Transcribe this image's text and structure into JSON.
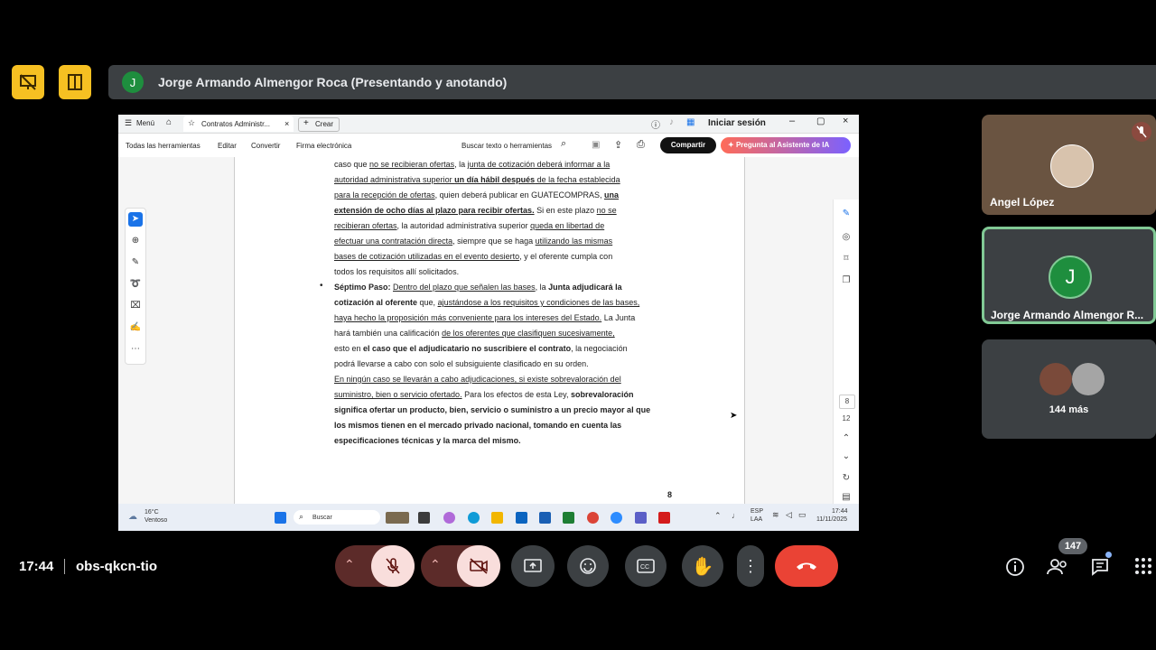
{
  "meeting": {
    "presenter_initial": "J",
    "presenter_title": "Jorge Armando Almengor Roca (Presentando y anotando)",
    "time": "17:44",
    "code": "obs-qkcn-tio",
    "participants_count": "147"
  },
  "window": {
    "menu_label": "Menú",
    "tab_title": "Contratos Administr...",
    "new_tab_label": "Crear",
    "signin_label": "Iniciar sesión",
    "toolbar_items": [
      "Todas las herramientas",
      "Editar",
      "Convertir",
      "Firma electrónica"
    ],
    "search_label": "Buscar texto o herramientas",
    "share_label": "Compartir",
    "ai_label": "Pregunta al Asistente de IA",
    "page_current": "8",
    "page_total": "12",
    "page_number": "8"
  },
  "doc_lines": [
    [
      {
        "t": "caso que "
      },
      {
        "t": "no se recibieran ofertas",
        "u": 1
      },
      {
        "t": ", la "
      },
      {
        "t": "junta de cotización deberá informar a la",
        "u": 1
      }
    ],
    [
      {
        "t": "autoridad administrativa superior ",
        "u": 1
      },
      {
        "t": "un día hábil después",
        "b": 1,
        "u": 1
      },
      {
        "t": " de la fecha establecida",
        "u": 1
      }
    ],
    [
      {
        "t": "para la recepción de ofertas",
        "u": 1
      },
      {
        "t": ", quien deberá publicar en GUATECOMPRAS, "
      },
      {
        "t": "una",
        "b": 1,
        "u": 1
      }
    ],
    [
      {
        "t": "extensión de ocho días al plazo para recibir ofertas.",
        "b": 1,
        "u": 1
      },
      {
        "t": " Si en este plazo "
      },
      {
        "t": "no se",
        "u": 1
      }
    ],
    [
      {
        "t": "recibieran ofertas",
        "u": 1
      },
      {
        "t": ", la autoridad administrativa superior "
      },
      {
        "t": "queda en libertad de",
        "u": 1
      }
    ],
    [
      {
        "t": "efectuar una contratación directa",
        "u": 1
      },
      {
        "t": ", siempre que se haga "
      },
      {
        "t": "utilizando las mismas",
        "u": 1
      }
    ],
    [
      {
        "t": "bases de cotización utilizadas en el evento desierto",
        "u": 1
      },
      {
        "t": ", y el oferente cumpla con"
      }
    ],
    [
      {
        "t": "todos los requisitos allí solicitados."
      }
    ],
    [
      {
        "t": "Séptimo Paso: ",
        "b": 1
      },
      {
        "t": "Dentro del plazo que señalen las bases",
        "u": 1
      },
      {
        "t": ", la "
      },
      {
        "t": "Junta adjudicará la",
        "b": 1
      }
    ],
    [
      {
        "t": "cotización al oferente",
        "b": 1
      },
      {
        "t": " que, "
      },
      {
        "t": "ajustándose a los requisitos y condiciones de las bases,",
        "u": 1
      }
    ],
    [
      {
        "t": "haya hecho la proposición más conveniente para los intereses del Estado.",
        "u": 1
      },
      {
        "t": " La Junta"
      }
    ],
    [
      {
        "t": "hará también una calificación "
      },
      {
        "t": "de los oferentes que clasifiquen sucesivamente,",
        "u": 1
      }
    ],
    [
      {
        "t": "esto en "
      },
      {
        "t": "el caso que el adjudicatario no suscribiere el contrato",
        "b": 1
      },
      {
        "t": ", la negociación"
      }
    ],
    [
      {
        "t": "podrá llevarse a cabo con solo el subsiguiente clasificado en su orden."
      }
    ],
    [
      {
        "t": "En ningún caso se llevarán a cabo adjudicaciones, si existe sobrevaloración del",
        "u": 1
      }
    ],
    [
      {
        "t": "suministro, bien o servicio ofertado.",
        "u": 1
      },
      {
        "t": " Para los efectos de esta Ley, "
      },
      {
        "t": "sobrevaloración",
        "b": 1
      }
    ],
    [
      {
        "t": "significa ofertar un producto, bien, servicio o suministro a un precio mayor al que",
        "b": 1
      }
    ],
    [
      {
        "t": "los mismos tienen en el mercado privado nacional, tomando en cuenta las",
        "b": 1
      }
    ],
    [
      {
        "t": "especificaciones técnicas y la marca del mismo.",
        "b": 1
      }
    ]
  ],
  "taskbar": {
    "weather_temp": "16°C",
    "weather_desc": "Ventoso",
    "search_label": "Buscar",
    "lang1": "ESP",
    "lang2": "LAA",
    "clock_time": "17:44",
    "clock_date": "11/11/2025"
  },
  "participants": {
    "tile1_name": "Angel López",
    "tile2_initial": "J",
    "tile2_name": "Jorge Armando Almengor R...",
    "tile3_label": "144 más"
  },
  "colors": {
    "meet_yellow": "#f6c022",
    "end_call_red": "#ea4335",
    "speaker_green": "#81c995",
    "acrobat_ai_gradient_start": "#ff6b57",
    "acrobat_ai_gradient_end": "#7b61ff"
  }
}
